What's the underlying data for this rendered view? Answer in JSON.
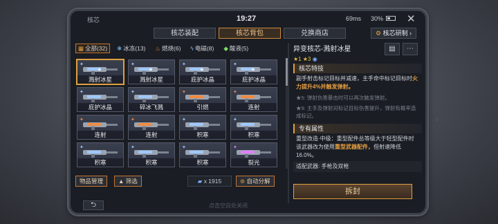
{
  "status": {
    "title": "核芯",
    "clock": "19:27",
    "net": "69ms",
    "battery": "30%"
  },
  "tabs": [
    {
      "label": "核芯装配",
      "active": false
    },
    {
      "label": "核芯背包",
      "active": true
    },
    {
      "label": "兑换商店",
      "active": false
    }
  ],
  "lab_button": "核芯研制 ›",
  "filters": [
    {
      "label": "全部(32)",
      "icon": "grid-icon",
      "active": true
    },
    {
      "label": "冰冻(13)",
      "icon": "snowflake-icon",
      "active": false
    },
    {
      "label": "燃烧(6)",
      "icon": "flame-icon",
      "active": false
    },
    {
      "label": "电磁(8)",
      "icon": "lightning-icon",
      "active": false
    },
    {
      "label": "酸液(5)",
      "icon": "acid-drop-icon",
      "active": false
    }
  ],
  "items": [
    {
      "label": "溅射冰星",
      "color": "#9ec8ff",
      "locked": true,
      "selected": true
    },
    {
      "label": "溅射冰星",
      "color": "#9ec8ff",
      "locked": true,
      "selected": false
    },
    {
      "label": "庇护冰晶",
      "color": "#9ec8ff",
      "locked": true,
      "selected": false
    },
    {
      "label": "庇护冰晶",
      "color": "#9ec8ff",
      "locked": true,
      "selected": false
    },
    {
      "label": "庇护冰晶",
      "color": "#9ec8ff",
      "locked": false,
      "selected": false
    },
    {
      "label": "碎冰飞溅",
      "color": "#9ec8ff",
      "locked": false,
      "selected": false
    },
    {
      "label": "引燃",
      "color": "#f08a40",
      "locked": false,
      "selected": false
    },
    {
      "label": "连射",
      "color": "#f08a40",
      "locked": false,
      "selected": false
    },
    {
      "label": "连射",
      "color": "#f08a40",
      "locked": false,
      "selected": false
    },
    {
      "label": "连射",
      "color": "#f08a40",
      "locked": false,
      "selected": false
    },
    {
      "label": "积寒",
      "color": "#9ec8ff",
      "locked": false,
      "selected": false
    },
    {
      "label": "积寒",
      "color": "#9ec8ff",
      "locked": false,
      "selected": false
    },
    {
      "label": "积寒",
      "color": "#9ec8ff",
      "locked": false,
      "selected": false
    },
    {
      "label": "积寒",
      "color": "#9ec8ff",
      "locked": false,
      "selected": false
    },
    {
      "label": "积寒",
      "color": "#9ec8ff",
      "locked": false,
      "selected": false
    },
    {
      "label": "裂光",
      "color": "#e080ff",
      "locked": false,
      "selected": false
    }
  ],
  "bottom": {
    "manage": "物品管理",
    "filter": "▲ 筛选",
    "count": "x 1915",
    "auto_dismantle": "自动分解"
  },
  "detail": {
    "name": "异变核芯-溅射冰星",
    "stats": "★1 ★3 ◉",
    "section1": "核芯特技",
    "desc1a": "副手射击标记目标并减速，主手命中标记目标时",
    "desc1b": "火力提升4%并触发弹射。",
    "note1": "★5: 弹射伤害暴击时可以再次触发弹射。",
    "note2": "★9: 主手及弹射对标记目标伤害提升，弹射有概率造成标记。",
    "section2": "专有属性",
    "desc2a": "重型改造·中级：重型配件总等级大于轻型配件时该武器改为使用",
    "desc2b": "重型武器配件，",
    "desc2c": "但射速降低16.0%。",
    "weapon": "适配武器: 手枪及双枪",
    "unseal": "拆封"
  },
  "back": "⮌",
  "hint": "点击空白处关闭"
}
